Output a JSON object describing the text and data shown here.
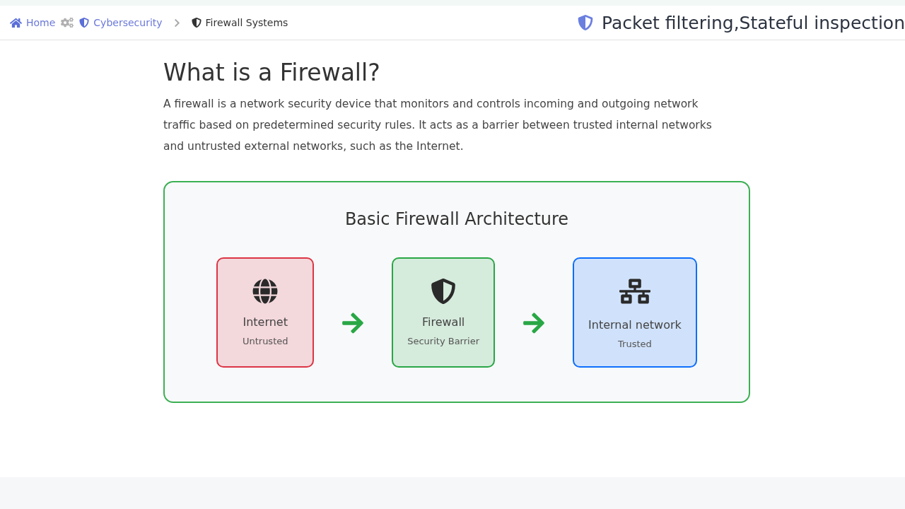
{
  "breadcrumb": [
    {
      "kind": "home",
      "label": "Home",
      "selected": false
    },
    {
      "kind": "topic",
      "label": "Cybersecurity",
      "selected": false
    },
    {
      "kind": "page",
      "label": "Firewall Systems",
      "selected": true
    }
  ],
  "header_title": "Packet filtering,Stateful inspection",
  "heading": "What is a Firewall?",
  "intro": "A firewall is a network security device that monitors and controls incoming and outgoing network traffic based on predetermined security rules. It acts as a barrier between trusted internal networks and untrusted external networks, such as the Internet.",
  "diagram": {
    "title": "Basic Firewall Architecture",
    "nodes": [
      {
        "kind": "internet",
        "label": "Internet",
        "caption": "Untrusted",
        "color": "#dc3545"
      },
      {
        "kind": "firewall",
        "label": "Firewall",
        "caption": "Security Barrier",
        "color": "#28a745"
      },
      {
        "kind": "network",
        "label": "Internal network",
        "caption": "Trusted",
        "color": "#0d6efd"
      }
    ]
  }
}
